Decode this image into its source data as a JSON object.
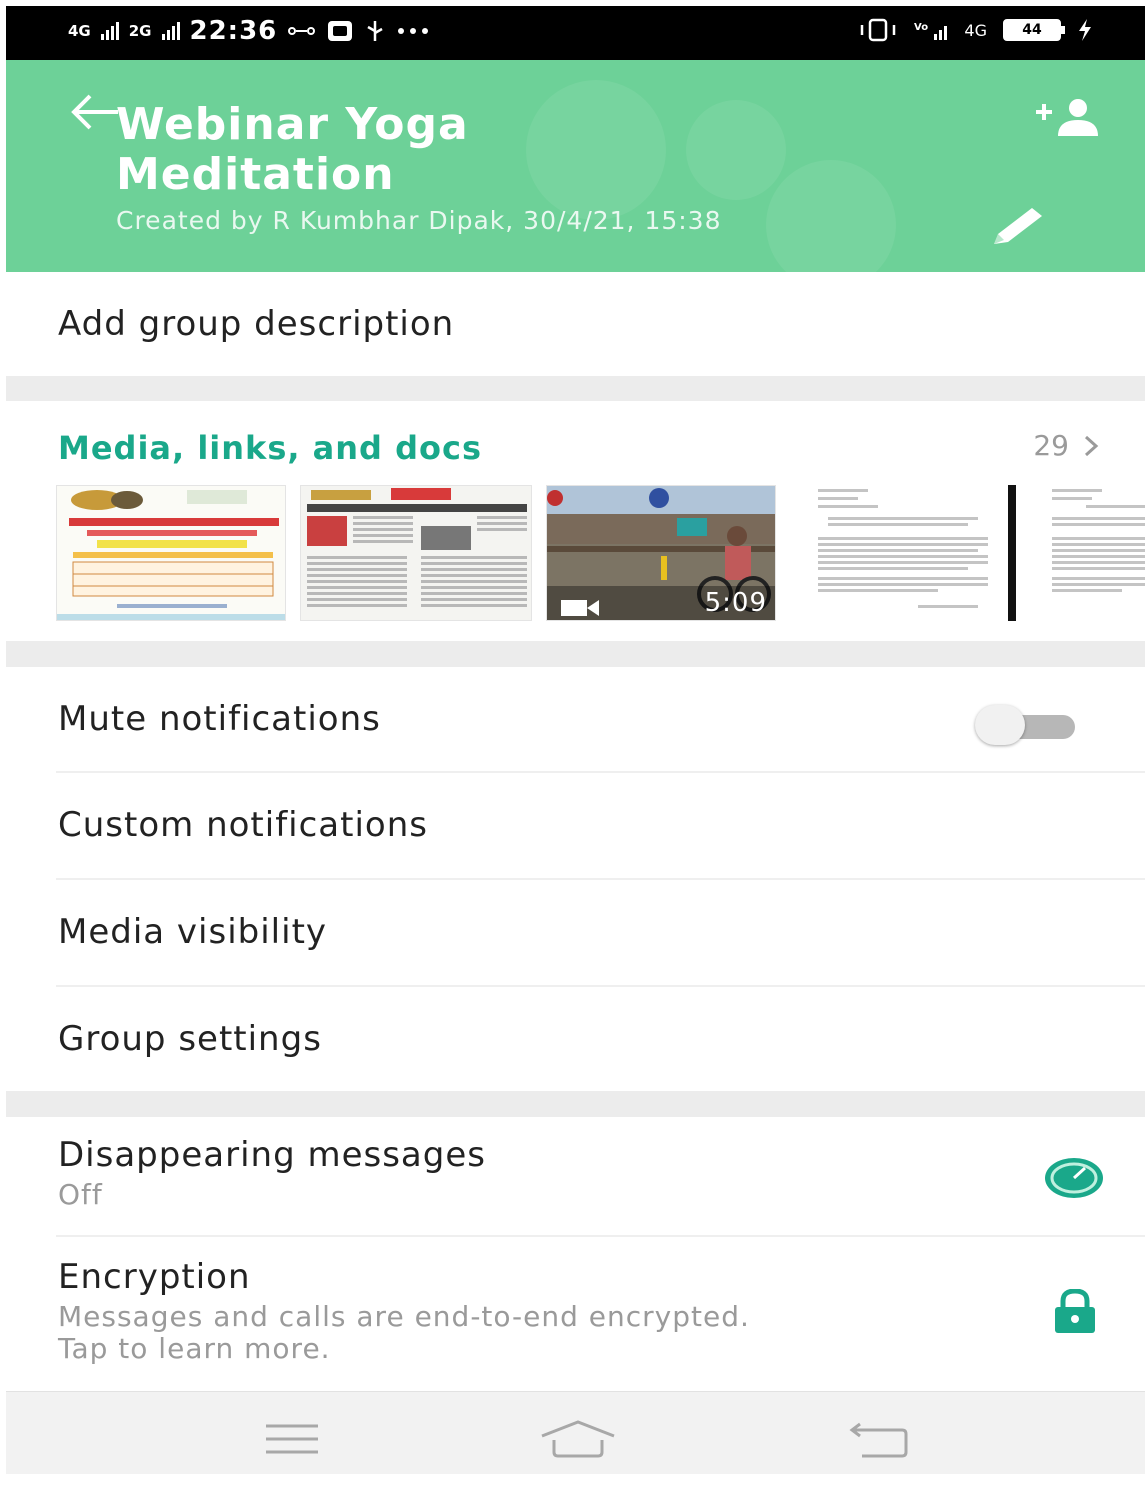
{
  "status_bar": {
    "signal_1": "4G",
    "signal_2": "2G",
    "time": "22:36",
    "net_icons": "4G",
    "battery": "44"
  },
  "header": {
    "title": "Webinar Yoga Meditation",
    "meta": "Created by R Kumbhar Dipak, 30/4/21, 15:38"
  },
  "description": {
    "label": "Add group description"
  },
  "media": {
    "title": "Media, links, and docs",
    "count": "29",
    "thumbnails": [
      {
        "kind": "image"
      },
      {
        "kind": "image"
      },
      {
        "kind": "video",
        "duration": "5:09"
      },
      {
        "kind": "document"
      },
      {
        "kind": "document"
      }
    ]
  },
  "settings": {
    "mute": {
      "label": "Mute notifications",
      "enabled": false
    },
    "custom": {
      "label": "Custom notifications"
    },
    "visibility": {
      "label": "Media visibility"
    },
    "group_settings": {
      "label": "Group settings"
    },
    "disappearing": {
      "label": "Disappearing messages",
      "value": "Off"
    },
    "encryption": {
      "label": "Encryption",
      "line1": "Messages and calls are end-to-end encrypted.",
      "line2": "Tap to learn more."
    }
  },
  "colors": {
    "header_green": "#6dd198",
    "accent_teal": "#1aa88a"
  },
  "icons": {
    "back": "arrow-left-icon",
    "add_participant": "add-person-icon",
    "edit": "pencil-icon",
    "chevron": "chevron-right-icon",
    "timer": "timer-icon",
    "lock": "lock-icon",
    "nav_menu": "menu-icon",
    "nav_home": "home-icon",
    "nav_back": "back-icon"
  }
}
